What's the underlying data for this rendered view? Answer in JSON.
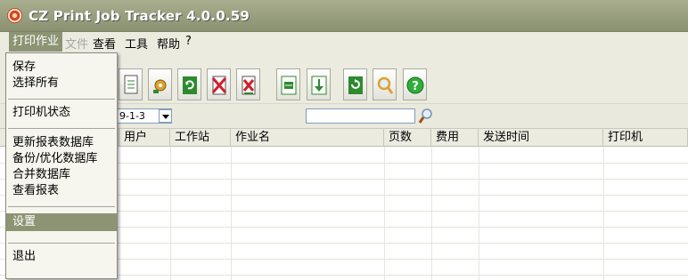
{
  "window": {
    "title": "CZ Print Job Tracker 4.0.0.59",
    "icon": "app-printer-icon"
  },
  "menubar": {
    "items": [
      {
        "label": "打印作业",
        "state": "active"
      },
      {
        "label": "文件",
        "state": "disabled"
      },
      {
        "label": "查看",
        "state": "normal"
      },
      {
        "label": "工具",
        "state": "normal"
      },
      {
        "label": "帮助",
        "state": "normal"
      },
      {
        "label": "?",
        "state": "normal"
      }
    ]
  },
  "dropdown": {
    "items": [
      {
        "label": "保存"
      },
      {
        "label": "选择所有"
      },
      {
        "label": "打印机状态"
      },
      {
        "label": "更新报表数据库"
      },
      {
        "label": "备份/优化数据库"
      },
      {
        "label": "合并数据库"
      },
      {
        "label": "查看报表"
      },
      {
        "label": "设置",
        "highlighted": true
      },
      {
        "label": "退出"
      }
    ]
  },
  "toolbar": {
    "buttons": [
      {
        "icon": "document-icon"
      },
      {
        "icon": "settings-gear-icon"
      },
      {
        "icon": "refresh-icon"
      },
      {
        "icon": "delete-icon"
      },
      {
        "icon": "delete-document-icon"
      },
      {
        "icon": "list-icon"
      },
      {
        "icon": "download-arrow-icon"
      },
      {
        "icon": "reload-icon"
      },
      {
        "icon": "search-icon"
      },
      {
        "icon": "help-icon"
      }
    ]
  },
  "filter": {
    "date_value": "9-1-3",
    "search_value": ""
  },
  "grid": {
    "columns": [
      "用户",
      "工作站",
      "作业名",
      "页数",
      "费用",
      "发送时间",
      "打印机"
    ]
  },
  "colors": {
    "accent": "#8c9473",
    "titlebar": "#9aa07f",
    "help_green": "#2fae3a",
    "toolbar_green": "#2e8a2e",
    "delete_red": "#d0202a"
  }
}
